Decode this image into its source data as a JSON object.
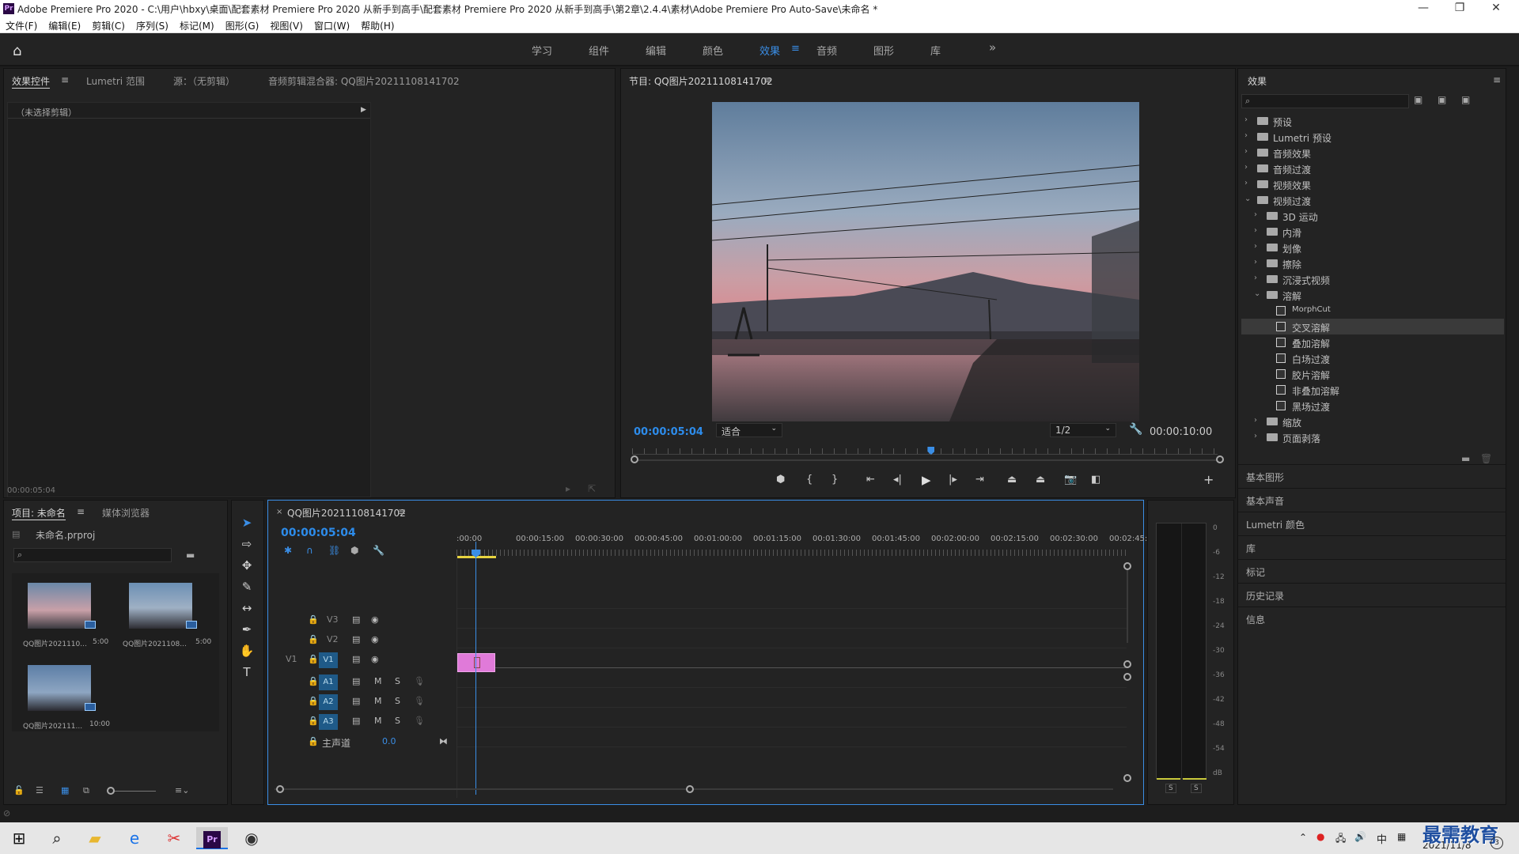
{
  "window": {
    "app_badge": "Pr",
    "title": "Adobe Premiere Pro 2020 - C:\\用户\\hbxy\\桌面\\配套素材 Premiere Pro 2020 从新手到高手\\配套素材 Premiere Pro 2020 从新手到高手\\第2章\\2.4.4\\素材\\Adobe Premiere Pro Auto-Save\\未命名 *",
    "minimize": "—",
    "maximize": "❐",
    "close": "✕"
  },
  "menu": [
    "文件(F)",
    "编辑(E)",
    "剪辑(C)",
    "序列(S)",
    "标记(M)",
    "图形(G)",
    "视图(V)",
    "窗口(W)",
    "帮助(H)"
  ],
  "workspaces": {
    "items": [
      "学习",
      "组件",
      "编辑",
      "颜色",
      "效果",
      "音频",
      "图形",
      "库"
    ],
    "active": "效果",
    "active_menu": "≡",
    "more": "»"
  },
  "source_panel": {
    "tabs": [
      "效果控件",
      "Lumetri 范围",
      "源：（无剪辑）",
      "音频剪辑混合器: QQ图片20211108141702"
    ],
    "tab_menu": "≡",
    "no_clip": "（未选择剪辑）",
    "timecode": "00:00:05:04"
  },
  "program_monitor": {
    "title": "节目: QQ图片20211108141702",
    "title_menu": "≡",
    "timecode": "00:00:05:04",
    "fit": "适合",
    "resolution": "1/2",
    "duration": "00:00:10:00",
    "playhead_fraction": 0.51
  },
  "effects_panel": {
    "title": "效果",
    "menu": "≡",
    "tree": [
      {
        "label": "预设",
        "type": "folder",
        "level": 0,
        "expanded": false
      },
      {
        "label": "Lumetri 预设",
        "type": "folder",
        "level": 0,
        "expanded": false
      },
      {
        "label": "音频效果",
        "type": "folder",
        "level": 0,
        "expanded": false
      },
      {
        "label": "音频过渡",
        "type": "folder",
        "level": 0,
        "expanded": false
      },
      {
        "label": "视频效果",
        "type": "folder",
        "level": 0,
        "expanded": false
      },
      {
        "label": "视频过渡",
        "type": "folder",
        "level": 0,
        "expanded": true
      },
      {
        "label": "3D 运动",
        "type": "folder",
        "level": 1,
        "expanded": false
      },
      {
        "label": "内滑",
        "type": "folder",
        "level": 1,
        "expanded": false
      },
      {
        "label": "划像",
        "type": "folder",
        "level": 1,
        "expanded": false
      },
      {
        "label": "擦除",
        "type": "folder",
        "level": 1,
        "expanded": false
      },
      {
        "label": "沉浸式视频",
        "type": "folder",
        "level": 1,
        "expanded": false
      },
      {
        "label": "溶解",
        "type": "folder",
        "level": 1,
        "expanded": true
      },
      {
        "label": "MorphCut",
        "type": "effect",
        "level": 2
      },
      {
        "label": "交叉溶解",
        "type": "effect",
        "level": 2,
        "selected": true
      },
      {
        "label": "叠加溶解",
        "type": "effect",
        "level": 2
      },
      {
        "label": "白场过渡",
        "type": "effect",
        "level": 2
      },
      {
        "label": "胶片溶解",
        "type": "effect",
        "level": 2
      },
      {
        "label": "非叠加溶解",
        "type": "effect",
        "level": 2
      },
      {
        "label": "黑场过渡",
        "type": "effect",
        "level": 2
      },
      {
        "label": "缩放",
        "type": "folder",
        "level": 1,
        "expanded": false
      },
      {
        "label": "页面剥落",
        "type": "folder",
        "level": 1,
        "expanded": false
      }
    ],
    "collapsed_panels": [
      "基本图形",
      "基本声音",
      "Lumetri 颜色",
      "库",
      "标记",
      "历史记录",
      "信息"
    ]
  },
  "project_panel": {
    "tabs": [
      "项目: 未命名",
      "媒体浏览器"
    ],
    "tab_menu": "≡",
    "project_file": "未命名.prproj",
    "items": [
      {
        "name": "QQ图片2021110...",
        "duration": "5:00"
      },
      {
        "name": "QQ图片2021108...",
        "duration": "5:00"
      },
      {
        "name": "QQ图片202111...",
        "duration": "10:00"
      }
    ]
  },
  "timeline": {
    "close": "×",
    "title": "QQ图片20211108141702",
    "title_menu": "≡",
    "timecode": "00:00:05:04",
    "ruler": [
      ":00:00",
      "00:00:15:00",
      "00:00:30:00",
      "00:00:45:00",
      "00:01:00:00",
      "00:01:15:00",
      "00:01:30:00",
      "00:01:45:00",
      "00:02:00:00",
      "00:02:15:00",
      "00:02:30:00",
      "00:02:45:"
    ],
    "video_tracks": [
      "V3",
      "V2",
      "V1"
    ],
    "source_patch": "V1",
    "audio_tracks": [
      "A1",
      "A2",
      "A3"
    ],
    "mute": "M",
    "solo": "S",
    "master_label": "主声道",
    "master_value": "0.0"
  },
  "meter": {
    "ticks": [
      "0",
      "-6",
      "-12",
      "-18",
      "-24",
      "-30",
      "-36",
      "-42",
      "-48",
      "-54",
      "dB"
    ],
    "solo_left": "S",
    "solo_right": "S"
  },
  "taskbar": {
    "ime": "中",
    "date": "2021/11/8",
    "watermark": "最需教育",
    "notifications": "3"
  },
  "colors": {
    "accent": "#2d8ceb",
    "clip": "#e07ad9",
    "panel_bg": "#232323",
    "app_bg": "#1d1d1d"
  }
}
